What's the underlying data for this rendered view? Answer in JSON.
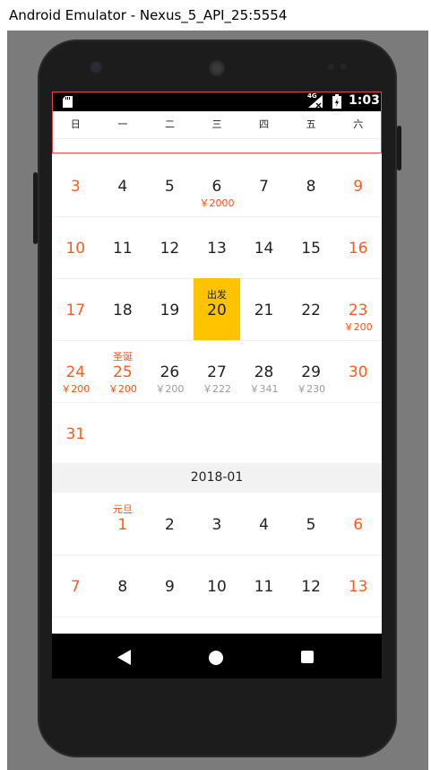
{
  "window": {
    "title": "Android Emulator - Nexus_5_API_25:5554"
  },
  "status_bar": {
    "network": "4G",
    "time": "1:03"
  },
  "weekdays": [
    "日",
    "一",
    "二",
    "三",
    "四",
    "五",
    "六"
  ],
  "colors": {
    "accent": "#ff5a1f",
    "selected": "#ffc300",
    "price_grey": "#9b9b9b"
  },
  "calendar": {
    "rows": [
      [
        {
          "day": "3",
          "type": "weekend"
        },
        {
          "day": "4"
        },
        {
          "day": "5"
        },
        {
          "day": "6",
          "price": "￥2000",
          "price_style": "accent"
        },
        {
          "day": "7"
        },
        {
          "day": "8"
        },
        {
          "day": "9",
          "type": "weekend"
        }
      ],
      [
        {
          "day": "10",
          "type": "weekend"
        },
        {
          "day": "11"
        },
        {
          "day": "12"
        },
        {
          "day": "13"
        },
        {
          "day": "14"
        },
        {
          "day": "15"
        },
        {
          "day": "16",
          "type": "weekend"
        }
      ],
      [
        {
          "day": "17",
          "type": "weekend"
        },
        {
          "day": "18"
        },
        {
          "day": "19"
        },
        {
          "day": "20",
          "top": "出发",
          "type": "selected"
        },
        {
          "day": "21"
        },
        {
          "day": "22"
        },
        {
          "day": "23",
          "type": "weekend",
          "price": "￥200",
          "price_style": "accent"
        }
      ],
      [
        {
          "day": "24",
          "type": "weekend",
          "price": "￥200",
          "price_style": "accent"
        },
        {
          "day": "25",
          "type": "holiday",
          "top": "圣诞",
          "price": "￥200",
          "price_style": "accent"
        },
        {
          "day": "26",
          "price": "￥200",
          "price_style": "grey"
        },
        {
          "day": "27",
          "price": "￥222",
          "price_style": "grey"
        },
        {
          "day": "28",
          "price": "￥341",
          "price_style": "grey"
        },
        {
          "day": "29",
          "price": "￥230",
          "price_style": "grey"
        },
        {
          "day": "30",
          "type": "weekend"
        }
      ],
      [
        {
          "day": "31",
          "type": "weekend"
        }
      ]
    ],
    "next_month": {
      "label": "2018-01",
      "rows": [
        [
          null,
          {
            "day": "1",
            "type": "holiday",
            "top": "元旦"
          },
          {
            "day": "2"
          },
          {
            "day": "3"
          },
          {
            "day": "4"
          },
          {
            "day": "5"
          },
          {
            "day": "6",
            "type": "weekend"
          }
        ],
        [
          {
            "day": "7",
            "type": "weekend"
          },
          {
            "day": "8"
          },
          {
            "day": "9"
          },
          {
            "day": "10"
          },
          {
            "day": "11"
          },
          {
            "day": "12"
          },
          {
            "day": "13",
            "type": "weekend"
          }
        ]
      ]
    }
  }
}
